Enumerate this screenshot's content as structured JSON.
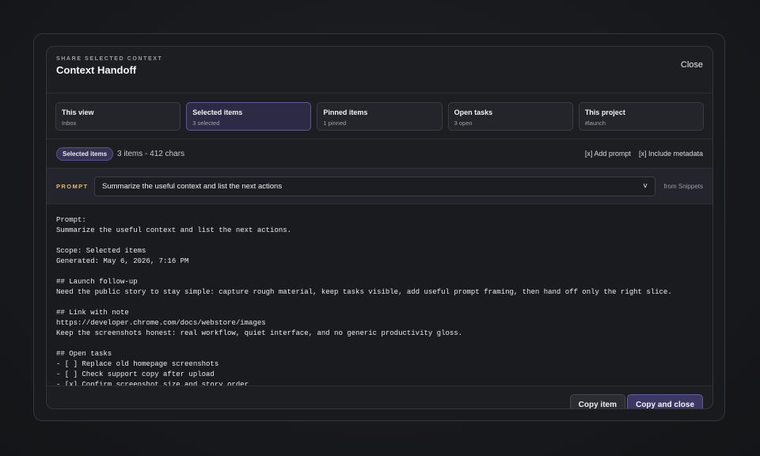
{
  "header": {
    "eyebrow": "SHARE SELECTED CONTEXT",
    "title": "Context Handoff",
    "close_label": "Close"
  },
  "tabs": [
    {
      "label": "This view",
      "sub": "Inbox",
      "active": false
    },
    {
      "label": "Selected items",
      "sub": "3 selected",
      "active": true
    },
    {
      "label": "Pinned items",
      "sub": "1 pinned",
      "active": false
    },
    {
      "label": "Open tasks",
      "sub": "3 open",
      "active": false
    },
    {
      "label": "This project",
      "sub": "#launch",
      "active": false
    }
  ],
  "summary": {
    "badge": "Selected items",
    "count": "3 items - 412 chars",
    "options": [
      "[x] Add prompt",
      "[x] Include metadata"
    ]
  },
  "prompt": {
    "label": "PROMPT",
    "selected": "Summarize the useful context and list the next actions",
    "chevron": "v",
    "source": "from Snippets"
  },
  "output_lines": [
    "Prompt:",
    "Summarize the useful context and list the next actions.",
    "",
    "Scope: Selected items",
    "Generated: May 6, 2026, 7:16 PM",
    "",
    "## Launch follow-up",
    "Need the public story to stay simple: capture rough material, keep tasks visible, add useful prompt framing, then hand off only the right slice.",
    "",
    "## Link with note",
    "https://developer.chrome.com/docs/webstore/images",
    "Keep the screenshots honest: real workflow, quiet interface, and no generic productivity gloss.",
    "",
    "## Open tasks",
    "- [ ] Replace old homepage screenshots",
    "- [ ] Check support copy after upload",
    "- [x] Confirm screenshot size and story order"
  ],
  "footer": {
    "copy_item": "Copy item",
    "copy_close": "Copy and close"
  }
}
